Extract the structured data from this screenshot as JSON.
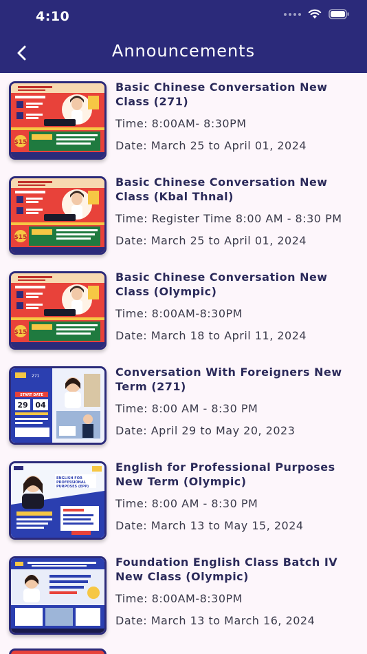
{
  "status": {
    "time": "4:10"
  },
  "header": {
    "title": "Announcements"
  },
  "icons": {
    "back": "chevron-left-icon",
    "wifi": "wifi-icon",
    "battery": "battery-icon"
  },
  "colors": {
    "header_bg": "#2b2a7a",
    "page_bg": "#fdf6fb",
    "poster_red": "#e8423a",
    "poster_blue": "#2b3fb0"
  },
  "announcements": [
    {
      "title": "Basic Chinese Conversation New Class (271)",
      "time": "Time: 8:00AM- 8:30PM",
      "date": "Date: March 25 to April 01, 2024",
      "poster": "chinese"
    },
    {
      "title": "Basic Chinese Conversation New Class (Kbal Thnal)",
      "time": "Time: Register Time 8:00 AM - 8:30 PM",
      "date": "Date: March 25 to April 01, 2024",
      "poster": "chinese"
    },
    {
      "title": "Basic Chinese Conversation New Class (Olympic)",
      "time": "Time: 8:00AM-8:30PM",
      "date": "Date: March 18 to April 11, 2024",
      "poster": "chinese"
    },
    {
      "title": "Conversation With Foreigners New Term (271)",
      "time": "Time: 8:00 AM - 8:30 PM",
      "date": "Date: April 29 to May 20, 2023",
      "poster": "foreigners"
    },
    {
      "title": "English for Professional Purposes New Term (Olympic)",
      "time": "Time: 8:00 AM - 8:30 PM",
      "date": "Date: March 13 to May 15, 2024",
      "poster": "epp"
    },
    {
      "title": "Foundation English Class Batch IV New Class (Olympic)",
      "time": "Time: 8:00AM-8:30PM",
      "date": "Date: March 13 to March 16, 2024",
      "poster": "foundation"
    }
  ],
  "posters": {
    "foreigners": {
      "badge": "271",
      "start": "START DATE",
      "day1": "29",
      "day2": "04"
    },
    "epp": {
      "heading": "ENGLISH FOR PROFESSIONAL PURPOSES (EPP)"
    }
  }
}
